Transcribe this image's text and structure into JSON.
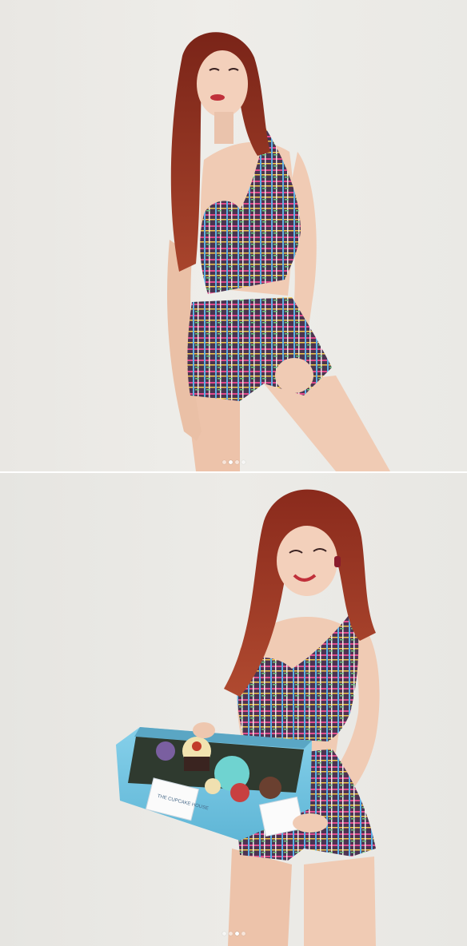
{
  "carousel": {
    "slides": [
      {
        "subject": "woman-in-tweed-crop-top-and-shorts",
        "dots": {
          "count": 4,
          "active_index": 1
        }
      },
      {
        "subject": "woman-holding-cupcake-box",
        "box_label": "THE CUPCAKE HOUSE",
        "dots": {
          "count": 4,
          "active_index": 2
        }
      }
    ]
  },
  "colors": {
    "wall": "#eceae6",
    "hair": "#8c2a1c",
    "skin": "#f0cbb4",
    "tweed_base": "#4a3550",
    "box": "#6fc4e0"
  }
}
